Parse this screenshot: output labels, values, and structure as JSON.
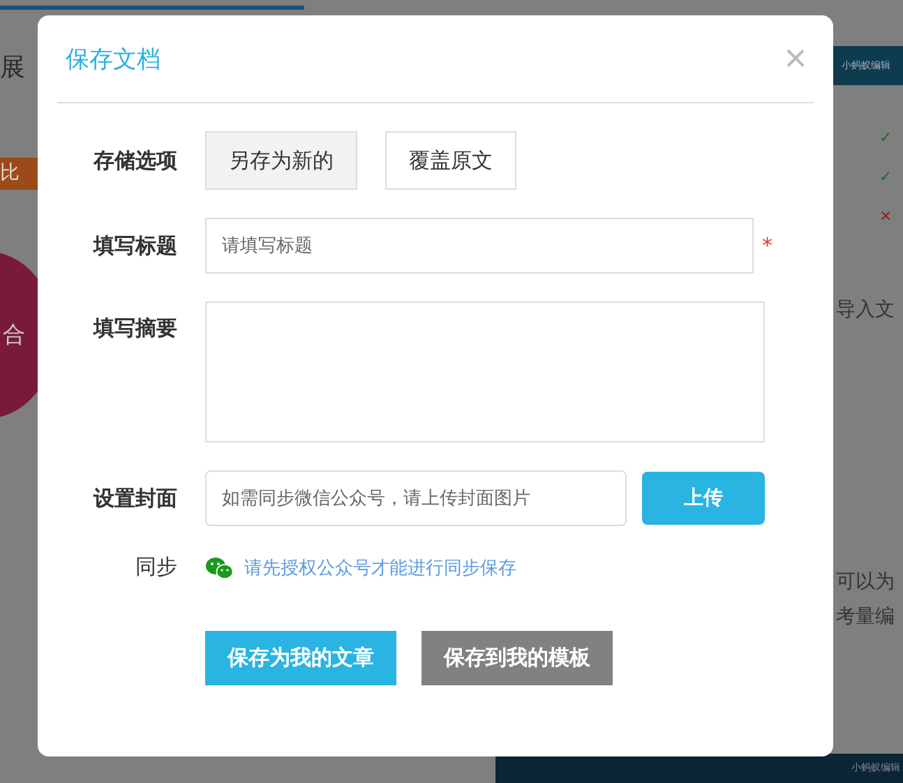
{
  "backdrop": {
    "heading": "展",
    "badge": "比",
    "circle_text": "合",
    "table_header": "小蚂蚁编辑",
    "table_marks": [
      {
        "text": "✓",
        "kind": "yes"
      },
      {
        "text": "✓",
        "kind": "yes"
      },
      {
        "text": "×",
        "kind": "no"
      }
    ],
    "side_texts": [
      "导入文",
      "可以为",
      "考量编"
    ],
    "footer": "小蚂蚁编辑"
  },
  "dialog": {
    "title": "保存文档",
    "close": "×",
    "storage": {
      "label": "存储选项",
      "options": [
        {
          "label": "另存为新的",
          "selected": true
        },
        {
          "label": "覆盖原文",
          "selected": false
        }
      ]
    },
    "title_field": {
      "label": "填写标题",
      "placeholder": "请填写标题",
      "required_mark": "*"
    },
    "summary_field": {
      "label": "填写摘要"
    },
    "cover": {
      "label": "设置封面",
      "placeholder": "如需同步微信公众号，请上传封面图片",
      "button": "上传"
    },
    "sync": {
      "label": "同步",
      "link": "请先授权公众号才能进行同步保存"
    },
    "buttons": [
      {
        "label": "保存为我的文章",
        "kind": "primary"
      },
      {
        "label": "保存到我的模板",
        "kind": "secondary"
      }
    ]
  }
}
